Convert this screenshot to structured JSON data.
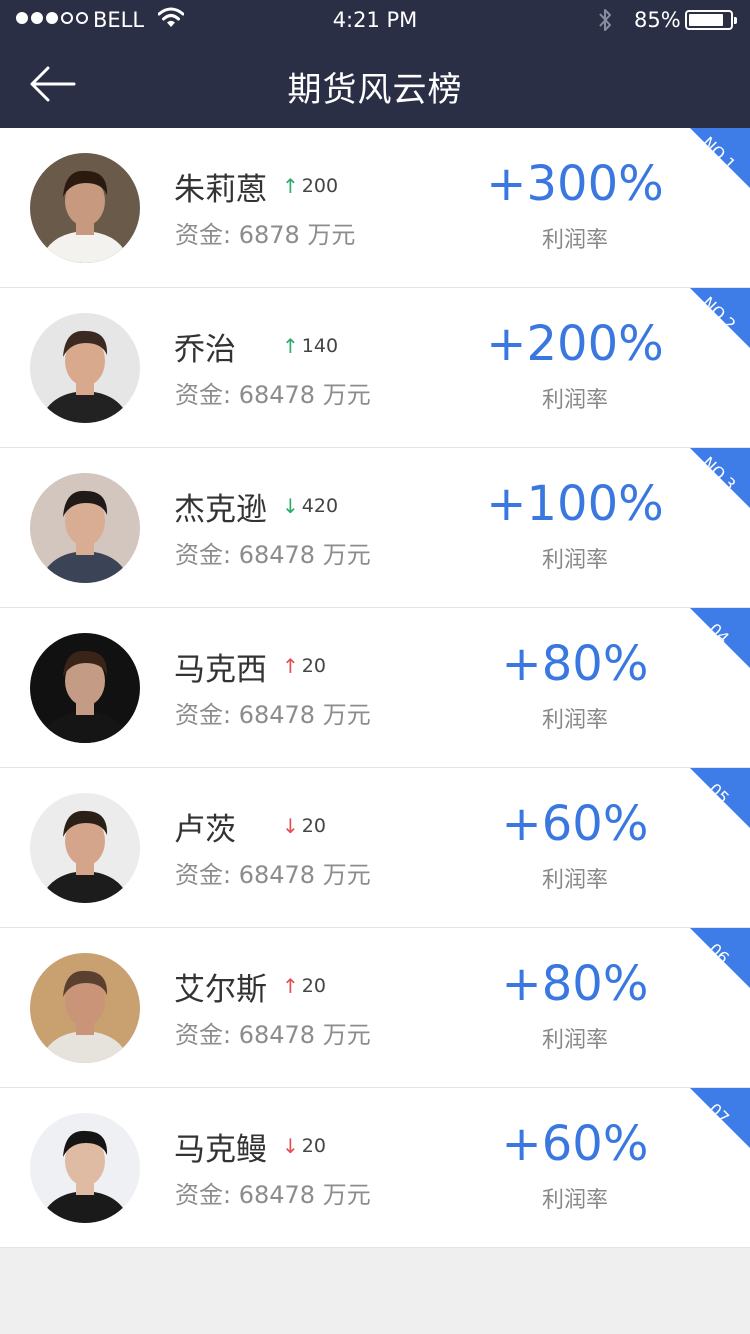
{
  "status_bar": {
    "carrier": "BELL",
    "time": "4:21 PM",
    "battery": "85%",
    "battery_level": 0.85
  },
  "header": {
    "title": "期货风云榜"
  },
  "colors": {
    "header_bg": "#2b2f45",
    "accent_blue": "#3a78e0",
    "ribbon_gold": "#3e7ce8",
    "up_green": "#2eaa6a",
    "up_red": "#e05050",
    "down_green": "#2eaa6a",
    "down_red": "#e05050"
  },
  "ranking": [
    {
      "rank_label": "NO.1",
      "ribbon_color": "#3e7ce8",
      "name": "朱莉蒽",
      "trend_dir": "up",
      "trend_color": "#2eaa6a",
      "trend_value": "200",
      "capital": "资金: 6878 万元",
      "rate": "+300%",
      "rate_label": "利润率",
      "avatar_bg": "#6a5a4a",
      "avatar_skin": "#c79a80",
      "avatar_hair": "#2a1a10",
      "avatar_cloth": "#f4f2ee"
    },
    {
      "rank_label": "NO.2",
      "ribbon_color": "#3e7ce8",
      "name": "乔治",
      "trend_dir": "up",
      "trend_color": "#2eaa6a",
      "trend_value": "140",
      "capital": "资金: 68478 万元",
      "rate": "+200%",
      "rate_label": "利润率",
      "avatar_bg": "#e6e6e6",
      "avatar_skin": "#d8a98c",
      "avatar_hair": "#3a2a22",
      "avatar_cloth": "#222"
    },
    {
      "rank_label": "NO.3",
      "ribbon_color": "#3e7ce8",
      "name": "杰克逊",
      "trend_dir": "down",
      "trend_color": "#2eaa6a",
      "trend_value": "420",
      "capital": "资金: 68478 万元",
      "rate": "+100%",
      "rate_label": "利润率",
      "avatar_bg": "#d2c6be",
      "avatar_skin": "#d9ad94",
      "avatar_hair": "#1f1a18",
      "avatar_cloth": "#3a4456"
    },
    {
      "rank_label": "04",
      "ribbon_color": "#3e7ce8",
      "name": "马克西",
      "trend_dir": "up",
      "trend_color": "#e05050",
      "trend_value": "20",
      "capital": "资金: 68478 万元",
      "rate": "+80%",
      "rate_label": "利润率",
      "avatar_bg": "#111",
      "avatar_skin": "#c49c86",
      "avatar_hair": "#3a2418",
      "avatar_cloth": "#151515"
    },
    {
      "rank_label": "05",
      "ribbon_color": "#3e7ce8",
      "name": "卢茨",
      "trend_dir": "down",
      "trend_color": "#e05050",
      "trend_value": "20",
      "capital": "资金: 68478 万元",
      "rate": "+60%",
      "rate_label": "利润率",
      "avatar_bg": "#ececec",
      "avatar_skin": "#d4a58a",
      "avatar_hair": "#2a2018",
      "avatar_cloth": "#1c1c1c"
    },
    {
      "rank_label": "06",
      "ribbon_color": "#3e7ce8",
      "name": "艾尔斯",
      "trend_dir": "up",
      "trend_color": "#e05050",
      "trend_value": "20",
      "capital": "资金: 68478 万元",
      "rate": "+80%",
      "rate_label": "利润率",
      "avatar_bg": "#c9a070",
      "avatar_skin": "#c99478",
      "avatar_hair": "#5a4030",
      "avatar_cloth": "#e6e2dc"
    },
    {
      "rank_label": "07",
      "ribbon_color": "#3e7ce8",
      "name": "马克鳗",
      "trend_dir": "down",
      "trend_color": "#e05050",
      "trend_value": "20",
      "capital": "资金: 68478 万元",
      "rate": "+60%",
      "rate_label": "利润率",
      "avatar_bg": "#eef0f4",
      "avatar_skin": "#e0bba3",
      "avatar_hair": "#151515",
      "avatar_cloth": "#1a1a1a"
    }
  ]
}
